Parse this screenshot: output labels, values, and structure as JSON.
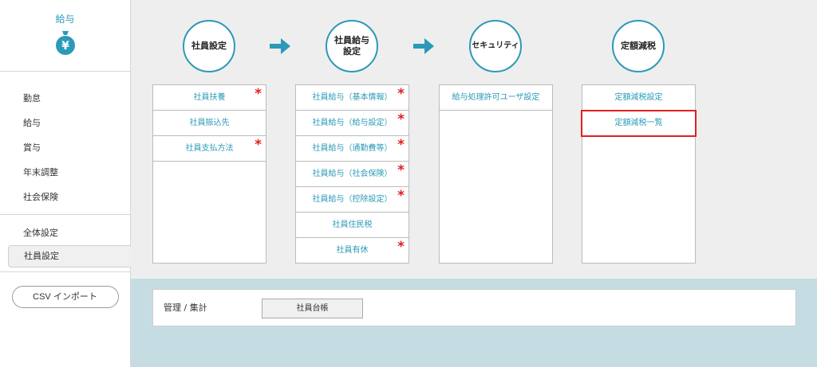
{
  "sidebar": {
    "title": "給与",
    "icon": "money-bag-yen-icon",
    "menu_group1": [
      {
        "label": "勤怠"
      },
      {
        "label": "給与"
      },
      {
        "label": "賞与"
      },
      {
        "label": "年末調整"
      },
      {
        "label": "社会保険"
      }
    ],
    "menu_group2": [
      {
        "label": "全体設定"
      },
      {
        "label": "社員設定"
      }
    ],
    "csv_import_label": "CSV インポート"
  },
  "steps": [
    {
      "title": "社員設定"
    },
    {
      "title": "社員給与\n設定"
    },
    {
      "title": "セキュリティ"
    },
    {
      "title": "定額減税"
    }
  ],
  "panels": [
    {
      "rows": [
        {
          "label": "社員扶養",
          "required": true
        },
        {
          "label": "社員振込先",
          "required": false
        },
        {
          "label": "社員支払方法",
          "required": true
        }
      ]
    },
    {
      "rows": [
        {
          "label": "社員給与（基本情報）",
          "required": true
        },
        {
          "label": "社員給与（給与設定）",
          "required": true
        },
        {
          "label": "社員給与（通勤費等）",
          "required": true
        },
        {
          "label": "社員給与（社会保険）",
          "required": true
        },
        {
          "label": "社員給与（控除設定）",
          "required": true
        },
        {
          "label": "社員住民税",
          "required": false
        },
        {
          "label": "社員有休",
          "required": true
        }
      ]
    },
    {
      "rows": [
        {
          "label": "給与処理許可ユーザ設定",
          "required": false
        }
      ]
    },
    {
      "rows": [
        {
          "label": "定額減税設定",
          "required": false
        },
        {
          "label": "定額減税一覧",
          "required": false,
          "selected": true
        }
      ]
    }
  ],
  "required_mark": "*",
  "management": {
    "label": "管理 / 集計",
    "ledger_button": "社員台帳"
  },
  "colors": {
    "accent": "#2b9ab8",
    "required": "#e02020",
    "bottom_bg": "#c5dde2"
  }
}
